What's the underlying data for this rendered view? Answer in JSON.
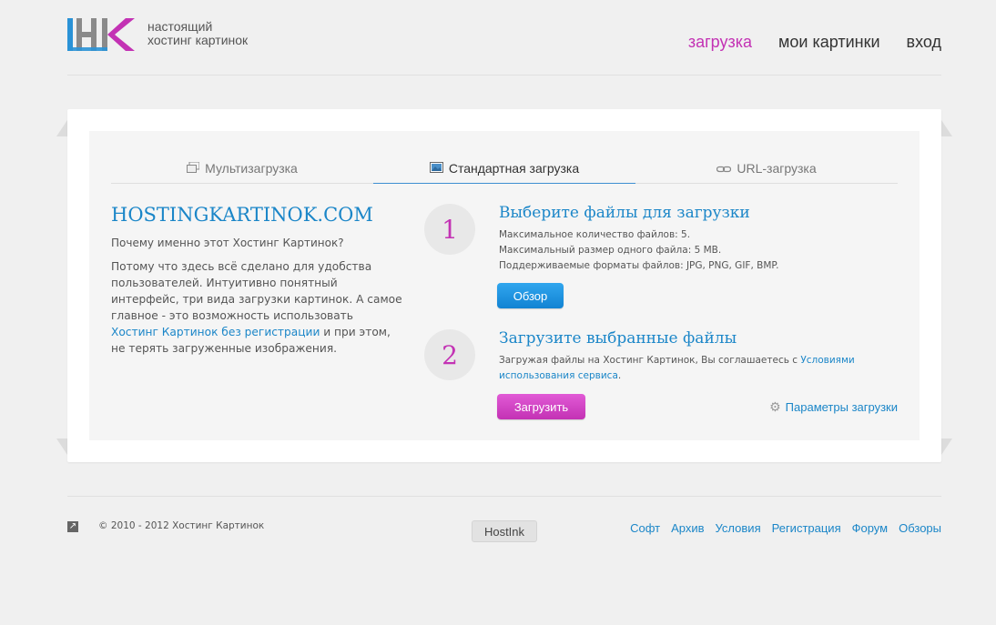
{
  "logo": {
    "text_line1": "настоящий",
    "text_line2": "хостинг картинок",
    "colors": {
      "blue": "#2a92d6",
      "gray": "#8a8a8a",
      "pink": "#c332b4"
    }
  },
  "nav": {
    "upload": "загрузка",
    "my_images": "мои картинки",
    "login": "вход"
  },
  "tabs": [
    {
      "label": "Мультизагрузка",
      "icon": "multi-upload-icon",
      "active": false
    },
    {
      "label": "Стандартная загрузка",
      "icon": "image-icon",
      "active": true
    },
    {
      "label": "URL-загрузка",
      "icon": "link-icon",
      "active": false
    }
  ],
  "intro": {
    "title": "HOSTINGKARTINOK.COM",
    "question": "Почему именно этот Хостинг Картинок?",
    "desc_part1": "Потому что здесь всё сделано для удобства пользователей. Интуитивно понятный интерфейс, три вида загрузки картинок. А самое главное - это возможность использовать ",
    "desc_link": "Хостинг Картинок без регистрации",
    "desc_part2": " и при этом, не терять загруженные изображения."
  },
  "step1": {
    "number": "1",
    "title": "Выберите файлы для загрузки",
    "line1": "Максимальное количество файлов: 5.",
    "line2": "Максимальный размер одного файла: 5 MB.",
    "line3": "Поддерживаемые форматы файлов: JPG, PNG, GIF, BMP.",
    "button": "Обзор"
  },
  "step2": {
    "number": "2",
    "title": "Загрузите выбранные файлы",
    "text_part1": "Загружая файлы на Хостинг Картинок, Вы соглашаетесь с ",
    "text_link": "Условиями использования сервиса",
    "text_part2": ".",
    "button": "Загрузить",
    "params": "Параметры загрузки"
  },
  "footer": {
    "arrow_icon": "external-arrow-icon",
    "copyright": "© 2010 - 2012 Хостинг Картинок",
    "badge": "HostInk",
    "links": [
      "Софт",
      "Архив",
      "Условия",
      "Регистрация",
      "Форум",
      "Обзоры"
    ]
  },
  "colors": {
    "accent_blue": "#1b86c8",
    "accent_pink": "#c332b4",
    "background": "#f0f0f0"
  }
}
